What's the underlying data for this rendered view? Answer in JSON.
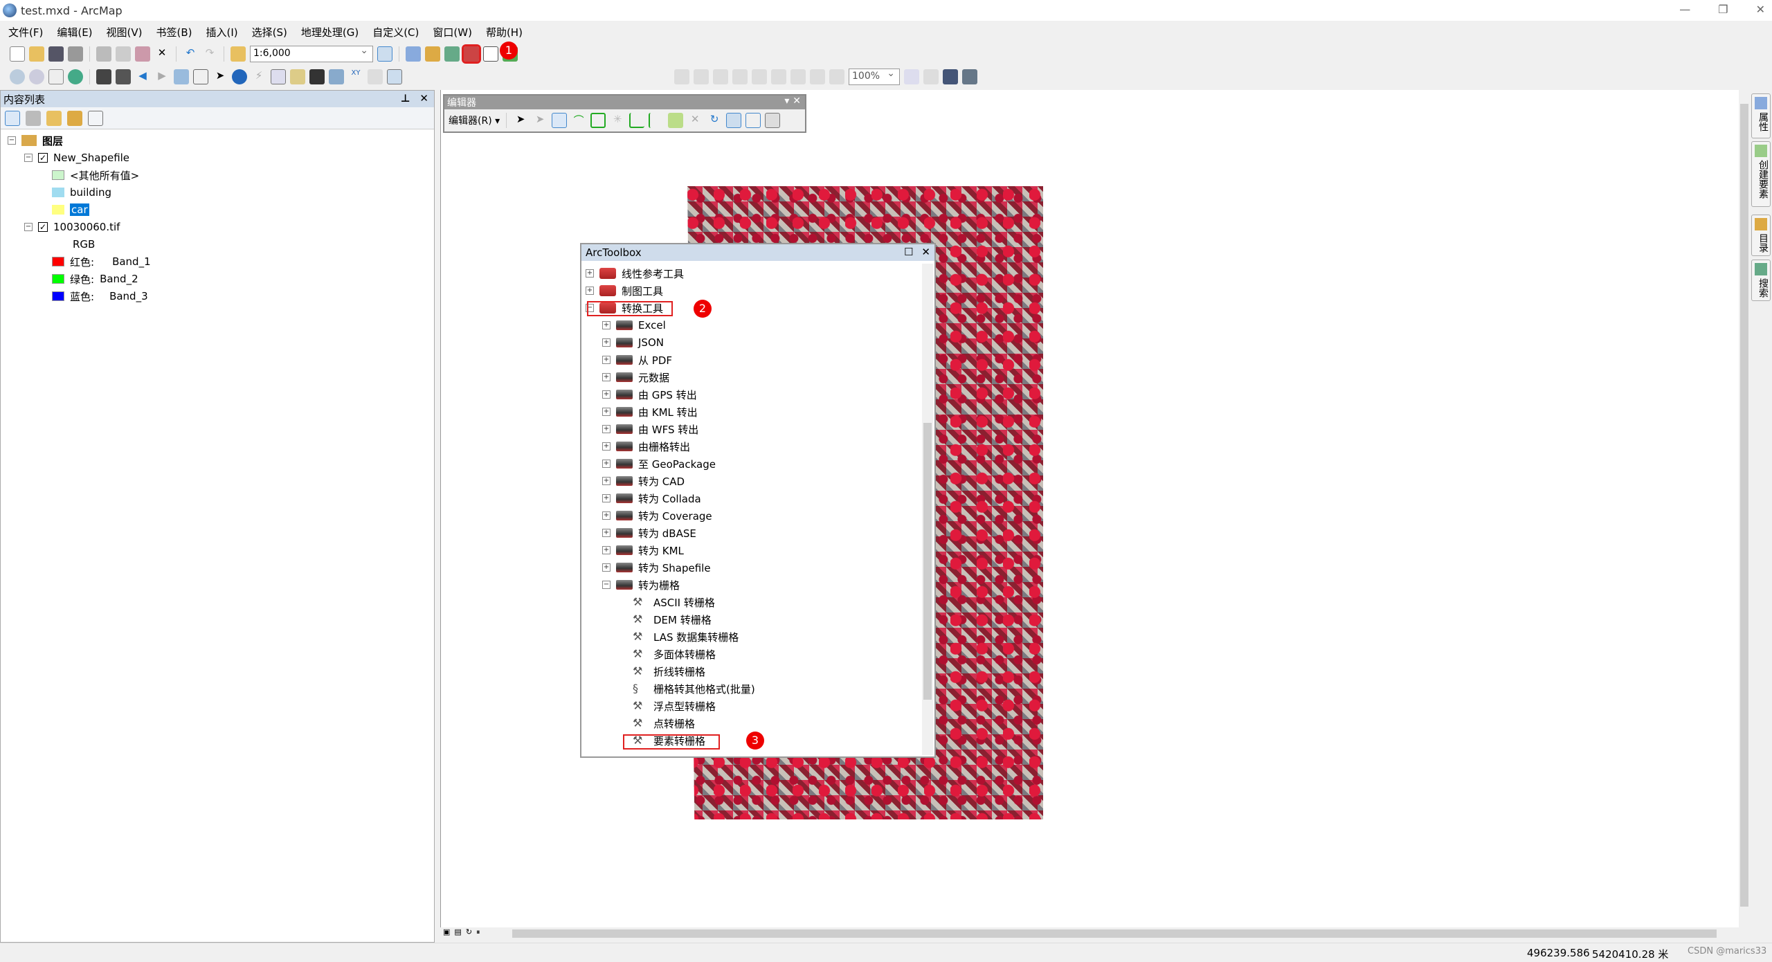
{
  "window": {
    "title": "test.mxd - ArcMap",
    "controls": [
      "—",
      "❐",
      "✕"
    ]
  },
  "menu": [
    "文件(F)",
    "编辑(E)",
    "视图(V)",
    "书签(B)",
    "插入(I)",
    "选择(S)",
    "地理处理(G)",
    "自定义(C)",
    "窗口(W)",
    "帮助(H)"
  ],
  "toolbar": {
    "scale": "1:6,000",
    "layout_zoom": "100%"
  },
  "toc": {
    "title": "内容列表",
    "root": "图层",
    "layers": [
      {
        "name": "New_Shapefile",
        "checked": true,
        "classes": [
          {
            "label": "<其他所有值>",
            "color": "#ccf5cc"
          },
          {
            "label": "building",
            "color": "#a0dcf0"
          },
          {
            "label": "car",
            "color": "#ffff80",
            "selected": true
          }
        ]
      },
      {
        "name": "10030060.tif",
        "checked": true,
        "sub": "RGB",
        "bands": [
          {
            "label": "红色:",
            "band": "Band_1",
            "color": "#ff0000"
          },
          {
            "label": "绿色:",
            "band": "Band_2",
            "color": "#00ff00"
          },
          {
            "label": "蓝色:",
            "band": "Band_3",
            "color": "#0000ff"
          }
        ]
      }
    ]
  },
  "editor": {
    "title": "编辑器",
    "menu": "编辑器(R) ▾"
  },
  "toolbox": {
    "title": "ArcToolbox",
    "top": [
      "线性参考工具",
      "制图工具",
      "转换工具"
    ],
    "sets": [
      "Excel",
      "JSON",
      "从 PDF",
      "元数据",
      "由 GPS 转出",
      "由 KML 转出",
      "由 WFS 转出",
      "由栅格转出",
      "至 GeoPackage",
      "转为 CAD",
      "转为 Collada",
      "转为 Coverage",
      "转为 dBASE",
      "转为 KML",
      "转为 Shapefile",
      "转为栅格"
    ],
    "tools": [
      "ASCII 转栅格",
      "DEM 转栅格",
      "LAS 数据集转栅格",
      "多面体转栅格",
      "折线转栅格",
      "栅格转其他格式(批量)",
      "浮点型转栅格",
      "点转栅格",
      "要素转栅格"
    ]
  },
  "badges": [
    "1",
    "2",
    "3"
  ],
  "right_tabs": [
    "属性",
    "创建要素",
    "目录",
    "搜索"
  ],
  "status": {
    "x": "496239.586",
    "y": "5420410.28 米",
    "watermark": "CSDN @marics33"
  },
  "colors": {
    "highlight": "#e02020",
    "panel_header": "#cfdceb",
    "selection": "#0078d7"
  }
}
